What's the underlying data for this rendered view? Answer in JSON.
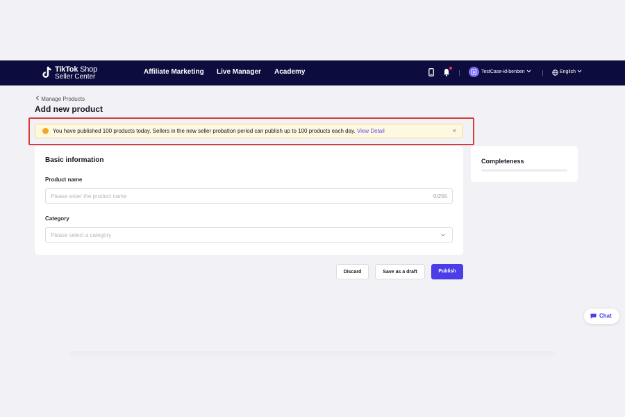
{
  "header": {
    "logo_brand": "TikTok",
    "logo_shop": "Shop",
    "logo_subtitle": "Seller Center",
    "nav": [
      {
        "label": "Affiliate Marketing"
      },
      {
        "label": "Live Manager"
      },
      {
        "label": "Academy"
      }
    ],
    "account_name": "TestCase-id-benben",
    "language": "English",
    "icons": [
      "phone-icon",
      "bell-icon",
      "avatar",
      "globe-icon"
    ]
  },
  "breadcrumb": {
    "label": "Manage Products"
  },
  "page": {
    "title": "Add new product"
  },
  "alert": {
    "message": "You have published 100 products today. Sellers in the new seller probation period can publish up to 100 products each day.",
    "link_label": "View Detail",
    "close_label": "×"
  },
  "basic_info": {
    "title": "Basic information",
    "product_name": {
      "label": "Product name",
      "placeholder": "Please enter the product name",
      "counter": "0/255"
    },
    "category": {
      "label": "Category",
      "placeholder": "Please select a category"
    }
  },
  "completeness": {
    "title": "Completeness",
    "progress": 0
  },
  "actions": {
    "discard": "Discard",
    "save_draft": "Save as a draft",
    "publish": "Publish"
  },
  "chat": {
    "label": "Chat"
  },
  "colors": {
    "topbar": "#0c0c3e",
    "primary": "#4b3de8",
    "alert_bg": "#fff8e1",
    "highlight_border": "#d63c3c"
  }
}
